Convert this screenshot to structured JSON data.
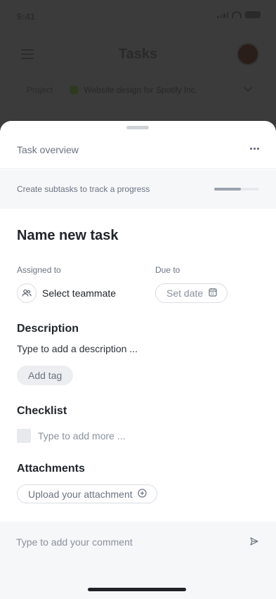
{
  "status_bar": {
    "time": "9:41"
  },
  "background": {
    "title": "Tasks",
    "project_label": "Project",
    "project_name": "Website design for Spotify Inc."
  },
  "sheet": {
    "header_title": "Task overview",
    "progress": {
      "text": "Create subtasks to track a progress",
      "value_fraction": 0.6
    },
    "task_name": "Name new task",
    "assigned": {
      "label": "Assigned to",
      "value": "Select teammate"
    },
    "due": {
      "label": "Due to",
      "value": "Set date"
    },
    "description": {
      "title": "Description",
      "placeholder": "Type to add a description ..."
    },
    "tag_button": "Add tag",
    "checklist": {
      "title": "Checklist",
      "placeholder": "Type to add more ..."
    },
    "attachments": {
      "title": "Attachments",
      "upload_label": "Upload your attachment"
    },
    "comment": {
      "placeholder": "Type to add your comment"
    }
  },
  "icons": {
    "more": "more-horizontal-icon",
    "teammate": "users-icon",
    "date": "calendar-icon",
    "upload": "plus-circle-icon",
    "send": "send-icon"
  },
  "colors": {
    "accent_progress": "#9aa2ad",
    "background_dim": "#3b3b3b"
  }
}
